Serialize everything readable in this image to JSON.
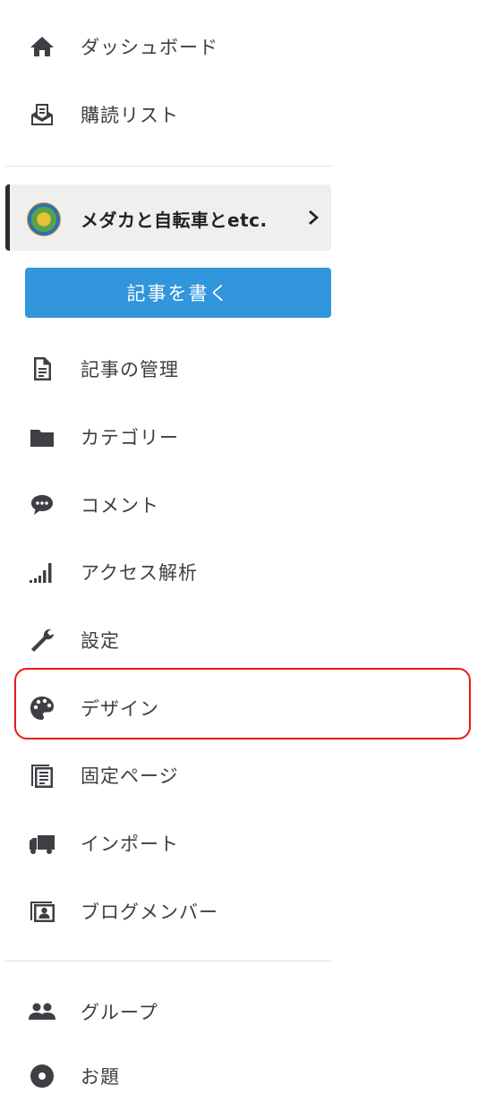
{
  "menu_top": [
    {
      "label": "ダッシュボード",
      "icon": "home-icon"
    },
    {
      "label": "購読リスト",
      "icon": "subscription-icon"
    }
  ],
  "blog": {
    "name": "メダカと自転車とetc.",
    "icon": "blog-avatar"
  },
  "write_button": {
    "label": "記事を書く"
  },
  "menu_blog": [
    {
      "label": "記事の管理",
      "icon": "document-icon"
    },
    {
      "label": "カテゴリー",
      "icon": "folder-icon"
    },
    {
      "label": "コメント",
      "icon": "comment-icon"
    },
    {
      "label": "アクセス解析",
      "icon": "signal-bars-icon"
    },
    {
      "label": "設定",
      "icon": "wrench-icon"
    },
    {
      "label": "デザイン",
      "icon": "palette-icon"
    },
    {
      "label": "固定ページ",
      "icon": "pages-icon"
    },
    {
      "label": "インポート",
      "icon": "truck-icon"
    },
    {
      "label": "ブログメンバー",
      "icon": "members-icon"
    }
  ],
  "menu_bottom": [
    {
      "label": "グループ",
      "icon": "group-icon"
    },
    {
      "label": "お題",
      "icon": "topic-icon"
    }
  ],
  "colors": {
    "accent": "#3196dc",
    "highlight": "#e81919",
    "active_bar": "#2b2b2b"
  }
}
